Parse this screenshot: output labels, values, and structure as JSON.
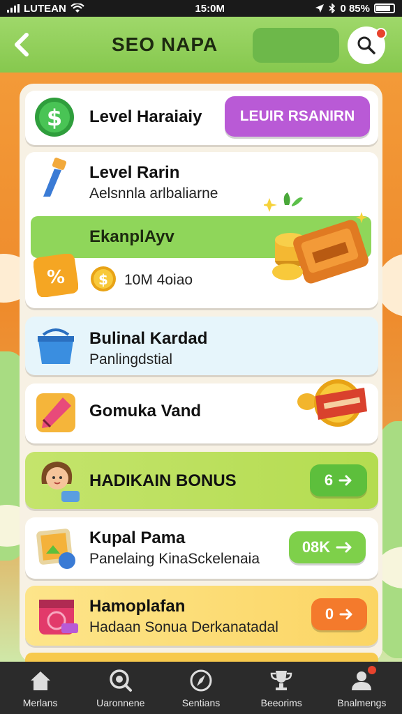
{
  "status_bar": {
    "carrier": "LUTEAN",
    "time": "15:0M",
    "battery": "0 85%"
  },
  "header": {
    "title": "SEO NAPA",
    "back_icon": "chevron-left-icon",
    "search_icon": "search-icon"
  },
  "cards": {
    "level_header": {
      "title": "Level Haraiaiy",
      "button": "LEUIR RSANIRN",
      "icon": "dollar-icon"
    },
    "level_rarin": {
      "title": "Level Rarin",
      "subtitle": "Aelsnnla arlbaliarne",
      "icon": "brush-icon"
    },
    "ekanplayv": {
      "title": "EkanplAyv",
      "amount": "10M 4oiao",
      "icon": "coin-icon"
    },
    "bulinal": {
      "title": "Bulinal Kardad",
      "subtitle": "Panlingdstial",
      "icon": "basket-icon"
    },
    "gomuka": {
      "title": "Gomuka Vand",
      "icon": "marker-icon"
    },
    "hadikain": {
      "title": "HADIKAIN BONUS",
      "button": "6",
      "icon": "avatar-icon"
    },
    "kupal": {
      "title": "Kupal Pama",
      "subtitle": "Panelaing KinaSckelenaia",
      "button": "08K",
      "icon": "photo-icon"
    },
    "hamoplafan": {
      "title": "Hamoplafan",
      "subtitle": "Hadaan Sonua Derkanatadal",
      "button": "0",
      "icon": "calendar-icon"
    }
  },
  "colors": {
    "header_green": "#8fcf5a",
    "purple_button": "#b95ad6",
    "green_button": "#5dbf3c",
    "orange_button": "#f47a2c",
    "background_orange": "#f08a2c"
  },
  "bottom_nav": [
    {
      "label": "Merlans",
      "icon": "home-icon"
    },
    {
      "label": "Uaronnene",
      "icon": "search-circle-icon"
    },
    {
      "label": "Sentians",
      "icon": "compass-icon"
    },
    {
      "label": "Beeorims",
      "icon": "trophy-icon"
    },
    {
      "label": "Bnalmengs",
      "icon": "profile-icon"
    }
  ]
}
